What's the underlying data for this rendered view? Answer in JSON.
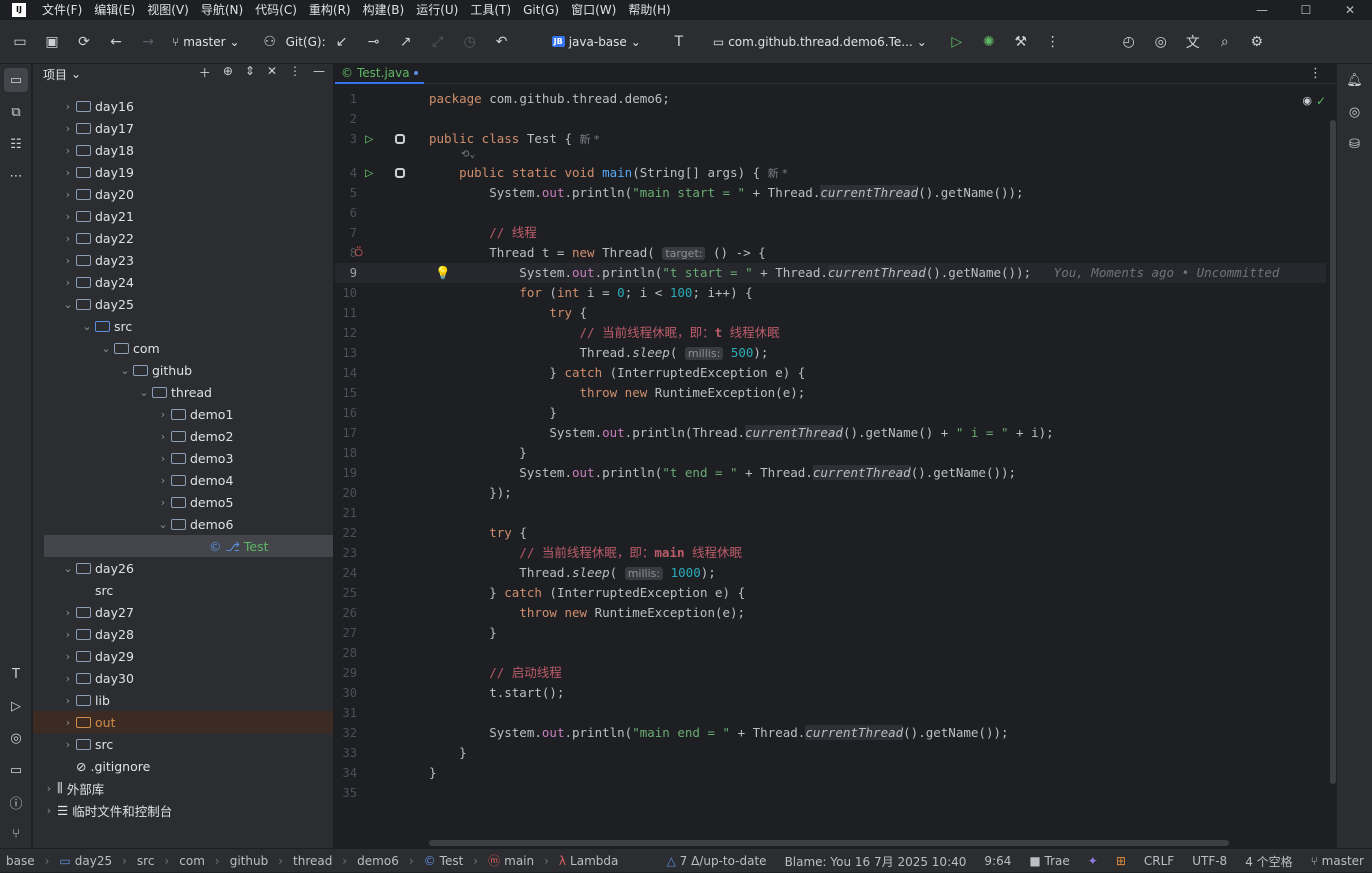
{
  "menu": [
    "文件(F)",
    "编辑(E)",
    "视图(V)",
    "导航(N)",
    "代码(C)",
    "重构(R)",
    "构建(B)",
    "运行(U)",
    "工具(T)",
    "Git(G)",
    "窗口(W)",
    "帮助(H)"
  ],
  "toolbar": {
    "branch": "master",
    "git_label": "Git(G):",
    "project": "java-base",
    "project_badge": "JB",
    "run_config": "com.github.thread.demo6.Te..."
  },
  "project_panel": {
    "title": "项目"
  },
  "tree": [
    {
      "label": "day16",
      "depth": 1,
      "arrow": "›",
      "kind": "folder"
    },
    {
      "label": "day17",
      "depth": 1,
      "arrow": "›",
      "kind": "folder"
    },
    {
      "label": "day18",
      "depth": 1,
      "arrow": "›",
      "kind": "folder"
    },
    {
      "label": "day19",
      "depth": 1,
      "arrow": "›",
      "kind": "folder"
    },
    {
      "label": "day20",
      "depth": 1,
      "arrow": "›",
      "kind": "folder"
    },
    {
      "label": "day21",
      "depth": 1,
      "arrow": "›",
      "kind": "folder"
    },
    {
      "label": "day22",
      "depth": 1,
      "arrow": "›",
      "kind": "folder"
    },
    {
      "label": "day23",
      "depth": 1,
      "arrow": "›",
      "kind": "folder"
    },
    {
      "label": "day24",
      "depth": 1,
      "arrow": "›",
      "kind": "folder"
    },
    {
      "label": "day25",
      "depth": 1,
      "arrow": "⌄",
      "kind": "folder"
    },
    {
      "label": "src",
      "depth": 2,
      "arrow": "⌄",
      "kind": "src"
    },
    {
      "label": "com",
      "depth": 3,
      "arrow": "⌄",
      "kind": "pkg"
    },
    {
      "label": "github",
      "depth": 4,
      "arrow": "⌄",
      "kind": "pkg"
    },
    {
      "label": "thread",
      "depth": 5,
      "arrow": "⌄",
      "kind": "pkg"
    },
    {
      "label": "demo1",
      "depth": 6,
      "arrow": "›",
      "kind": "pkg"
    },
    {
      "label": "demo2",
      "depth": 6,
      "arrow": "›",
      "kind": "pkg"
    },
    {
      "label": "demo3",
      "depth": 6,
      "arrow": "›",
      "kind": "pkg"
    },
    {
      "label": "demo4",
      "depth": 6,
      "arrow": "›",
      "kind": "pkg"
    },
    {
      "label": "demo5",
      "depth": 6,
      "arrow": "›",
      "kind": "pkg"
    },
    {
      "label": "demo6",
      "depth": 6,
      "arrow": "⌄",
      "kind": "pkg"
    },
    {
      "label": "Test",
      "depth": 8,
      "arrow": "",
      "kind": "class",
      "selected": true
    },
    {
      "label": "day26",
      "depth": 1,
      "arrow": "⌄",
      "kind": "folder"
    },
    {
      "label": "src",
      "depth": 2,
      "arrow": "",
      "kind": "plain"
    },
    {
      "label": "day27",
      "depth": 1,
      "arrow": "›",
      "kind": "folder"
    },
    {
      "label": "day28",
      "depth": 1,
      "arrow": "›",
      "kind": "folder"
    },
    {
      "label": "day29",
      "depth": 1,
      "arrow": "›",
      "kind": "folder"
    },
    {
      "label": "day30",
      "depth": 1,
      "arrow": "›",
      "kind": "folder"
    },
    {
      "label": "lib",
      "depth": 1,
      "arrow": "›",
      "kind": "folder"
    },
    {
      "label": "out",
      "depth": 1,
      "arrow": "›",
      "kind": "out"
    },
    {
      "label": "src",
      "depth": 1,
      "arrow": "›",
      "kind": "folder"
    },
    {
      "label": ".gitignore",
      "depth": 1,
      "arrow": "",
      "kind": "file"
    },
    {
      "label": "外部库",
      "depth": 0,
      "arrow": "›",
      "kind": "lib"
    },
    {
      "label": "临时文件和控制台",
      "depth": 0,
      "arrow": "›",
      "kind": "scratch"
    }
  ],
  "editor": {
    "tab": "Test.java"
  },
  "status": {
    "crumbs": [
      "base",
      "day25",
      "src",
      "com",
      "github",
      "thread",
      "demo6",
      "Test",
      "main",
      "Lambda"
    ],
    "vcs": "7 Δ/up-to-date",
    "blame": "Blame: You 16 7月 2025 10:40",
    "position": "9:64",
    "trae": "Trae",
    "line_sep": "CRLF",
    "encoding": "UTF-8",
    "indent": "4 个空格",
    "branch": "master"
  },
  "code_note": {
    "blame_inline": "You, Moments ago • Uncommitted"
  }
}
